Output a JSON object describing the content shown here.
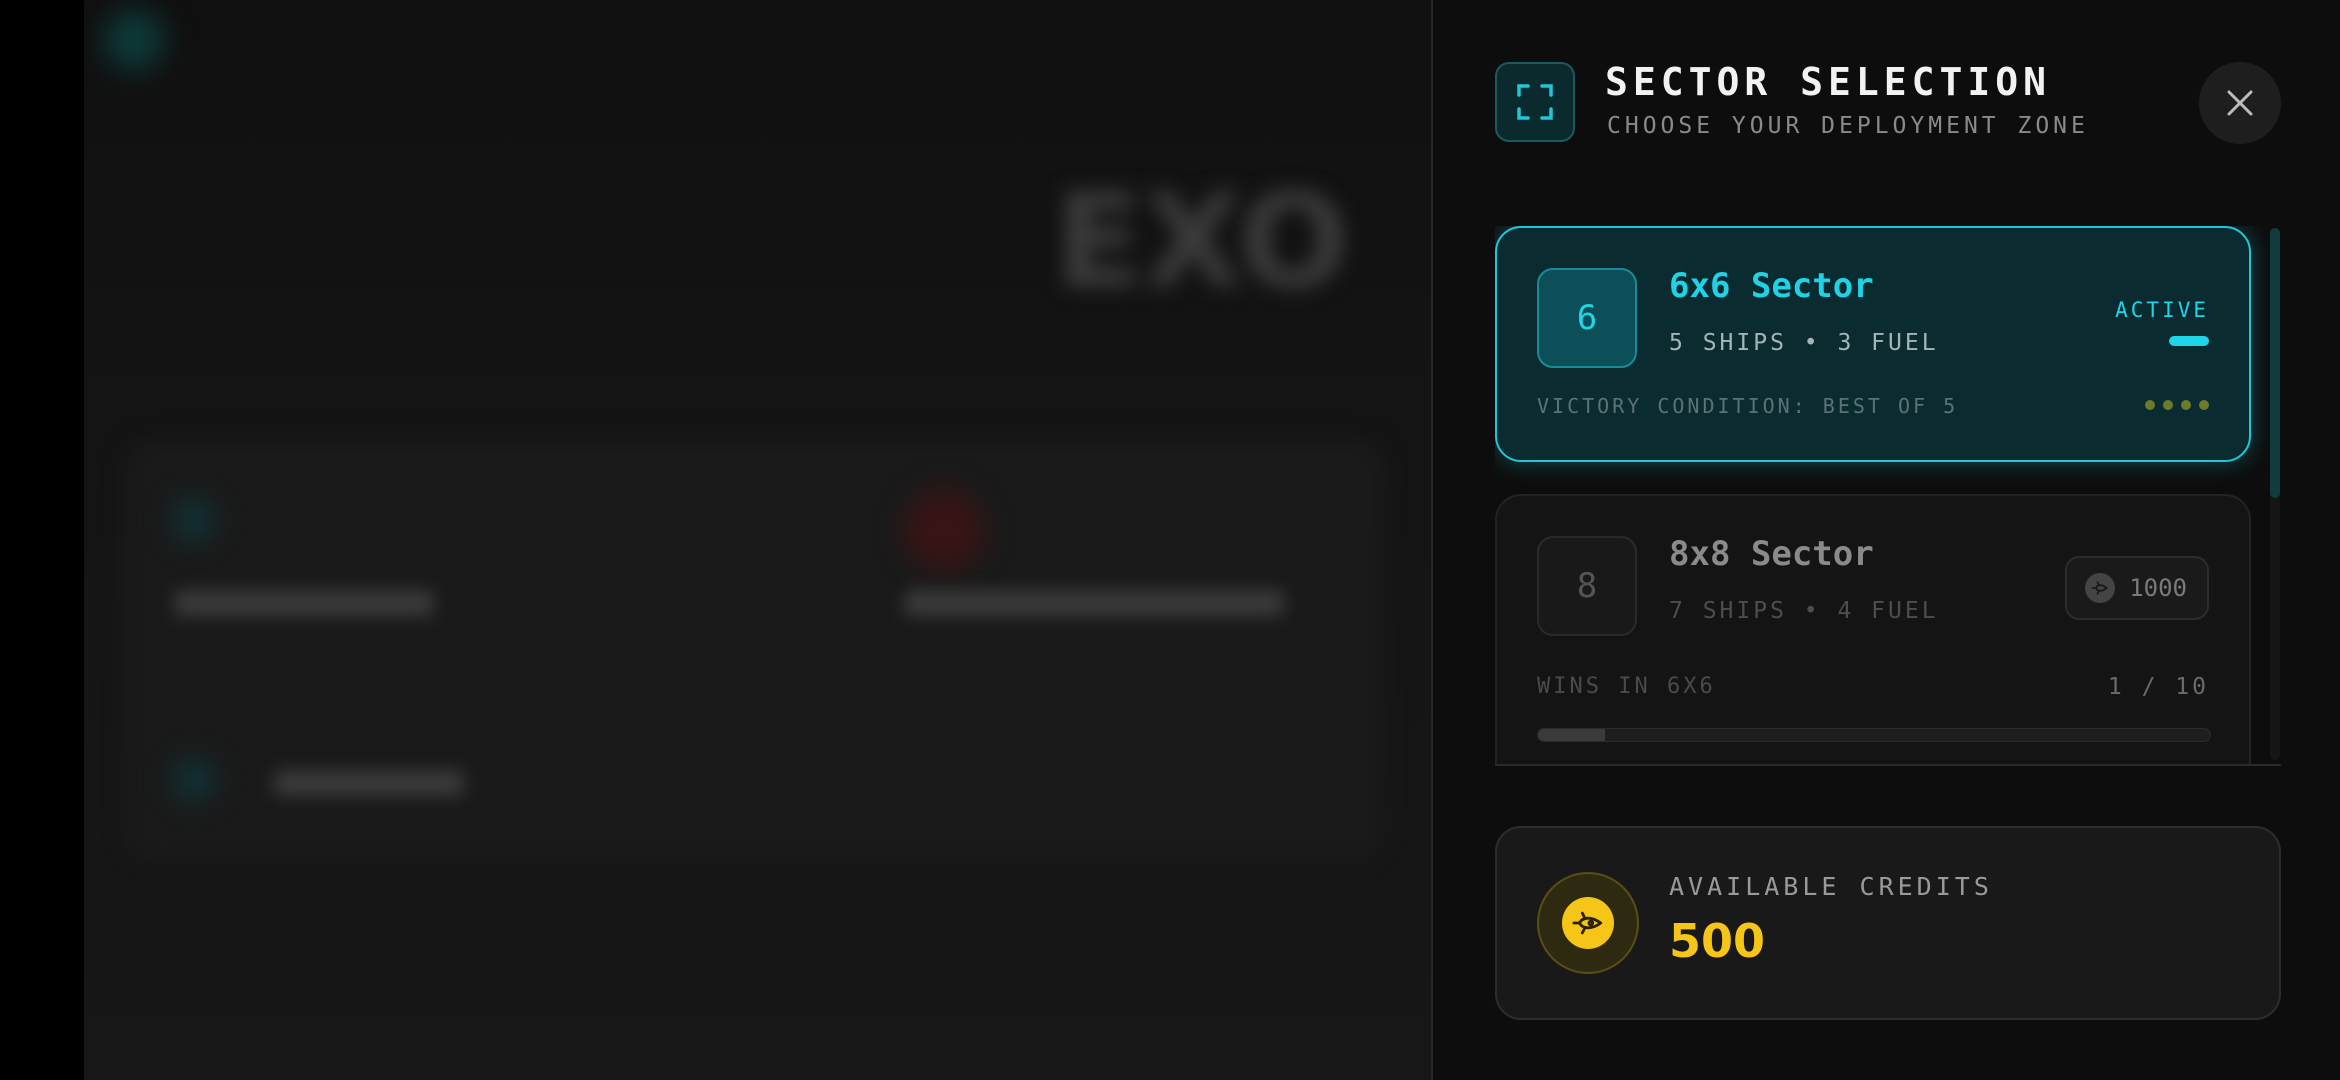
{
  "background": {
    "blurred_title": "EXO"
  },
  "header": {
    "title": "SECTOR SELECTION",
    "subtitle": "CHOOSE YOUR DEPLOYMENT ZONE",
    "icon": "expand-frame-icon",
    "close_icon": "close-icon"
  },
  "sectors": [
    {
      "number": "6",
      "name": "6x6 Sector",
      "stats": "5 SHIPS • 3 FUEL",
      "status": "ACTIVE",
      "footer": "VICTORY CONDITION: BEST OF 5"
    },
    {
      "number": "8",
      "name": "8x8 Sector",
      "stats": "7 SHIPS • 4 FUEL",
      "cost": "1000",
      "wins_label": "WINS IN 6X6",
      "wins_count": "1 / 10",
      "progress_fraction": 0.1
    }
  ],
  "credits": {
    "label": "AVAILABLE CREDITS",
    "value": "500",
    "icon": "rocket-coin-icon"
  },
  "colors": {
    "accent": "#1fd6e8",
    "gold": "#f5c518",
    "panel": "#0d0d0d"
  }
}
